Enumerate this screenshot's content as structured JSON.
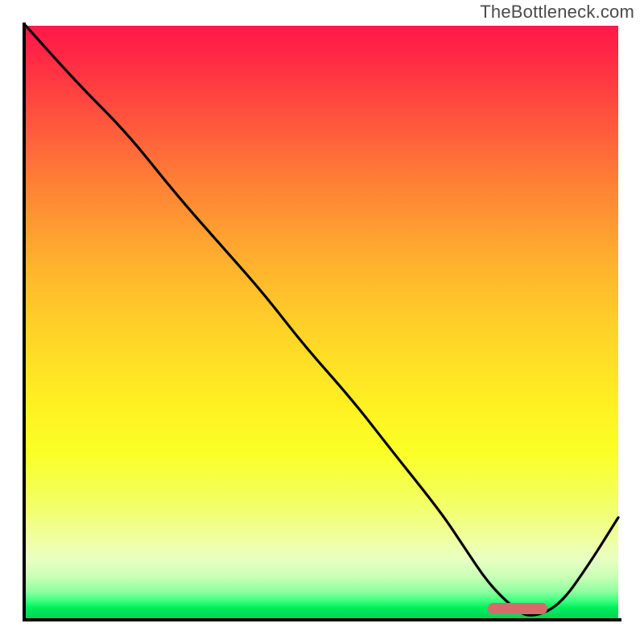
{
  "watermark_text": "TheBottleneck.com",
  "chart_data": {
    "type": "line",
    "title": "",
    "xlabel": "",
    "ylabel": "",
    "xlim": [
      0,
      100
    ],
    "ylim": [
      0,
      100
    ],
    "grid": false,
    "legend": false,
    "background": "gradient red→orange→yellow→green (top→bottom)",
    "series": [
      {
        "name": "bottleneck-curve",
        "x": [
          0,
          9,
          17,
          25,
          32,
          40,
          47,
          55,
          62,
          70,
          74,
          78,
          82,
          85,
          90,
          95,
          100
        ],
        "y": [
          100,
          90,
          82,
          72,
          64,
          55,
          46,
          37,
          28,
          18,
          12,
          6,
          2,
          0,
          2,
          9,
          17
        ]
      }
    ],
    "marker": {
      "name": "optimal-band",
      "x_start": 78,
      "x_end": 88,
      "y": 1,
      "color": "#d96a6a"
    }
  }
}
